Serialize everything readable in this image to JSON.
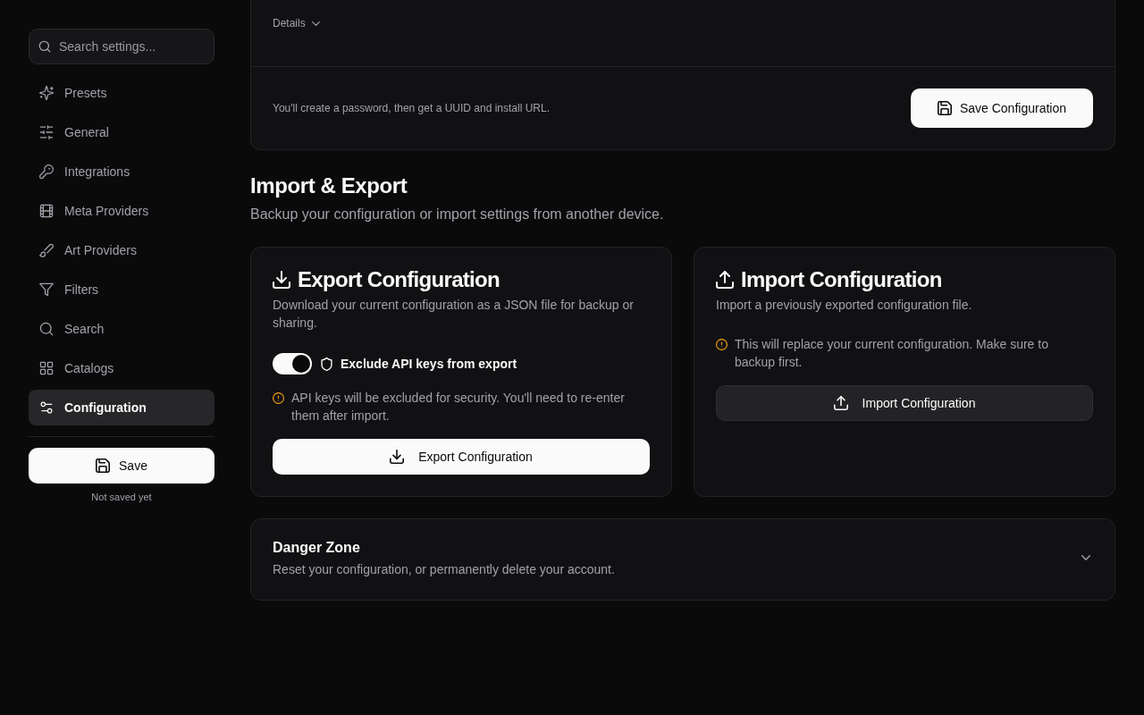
{
  "sidebar": {
    "search": {
      "placeholder": "Search settings..."
    },
    "items": [
      {
        "label": "Presets",
        "selected": false
      },
      {
        "label": "General",
        "selected": false
      },
      {
        "label": "Integrations",
        "selected": false
      },
      {
        "label": "Meta Providers",
        "selected": false
      },
      {
        "label": "Art Providers",
        "selected": false
      },
      {
        "label": "Filters",
        "selected": false
      },
      {
        "label": "Search",
        "selected": false
      },
      {
        "label": "Catalogs",
        "selected": false
      },
      {
        "label": "Configuration",
        "selected": true
      }
    ],
    "save_button": {
      "label": "Save"
    },
    "save_status": "Not saved yet"
  },
  "setup_card": {
    "details": {
      "label": "Details",
      "expanded": false
    },
    "note": "You'll create a password, then get a UUID and install URL.",
    "save_button": {
      "label": "Save Configuration"
    }
  },
  "import_export": {
    "title": "Import & Export",
    "subtitle": "Backup your configuration or import settings from another device.",
    "cards": [
      {
        "kind": "export",
        "title": "Export Configuration",
        "description": "Download your current configuration as a JSON file for backup or sharing.",
        "toggle": {
          "label": "Exclude API keys from export",
          "on": true
        },
        "warning": "API keys will be excluded for security. You'll need to re-enter them after import.",
        "button": {
          "label": "Export Configuration"
        }
      },
      {
        "kind": "import",
        "title": "Import Configuration",
        "description": "Import a previously exported configuration file.",
        "warning": "This will replace your current configuration. Make sure to backup first.",
        "button": {
          "label": "Import Configuration"
        }
      }
    ]
  },
  "danger_zone": {
    "title": "Danger Zone",
    "description": "Reset your configuration, or permanently delete your account.",
    "expanded": false
  }
}
